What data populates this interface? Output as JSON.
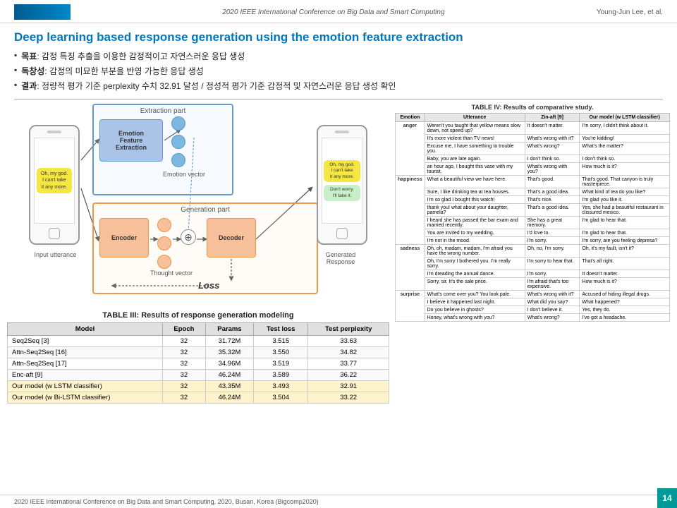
{
  "header": {
    "conference": "2020 IEEE International Conference on Big Data and Smart Computing",
    "author": "Young-Jun Lee, et al."
  },
  "title": "Deep learning based response generation using the emotion feature extraction",
  "bullets": [
    {
      "label": "목표",
      "text": ": 감정 특징 추출을 이용한 감정적이고 자연스러운 응답 생성"
    },
    {
      "label": "독창성",
      "text": ": 감정의 미묘한 부분을 반영 가능한 응답 생성"
    },
    {
      "label": "결과",
      "text": ": 정량적 평가 기준 perplexity 수치 32.91 달성 / 정성적 평가 기준 감정적 및 자연스러운 응답 생성 확인"
    }
  ],
  "diagram": {
    "extraction_label": "Extraction part",
    "efe_label": "Emotion\nFeature\nExtraction",
    "emotion_vector_label": "Emotion vector",
    "generation_label": "Generation part",
    "encoder_label": "Encoder",
    "decoder_label": "Decoder",
    "thought_vector_label": "Thought vector",
    "loss_label": "Loss",
    "input_label": "Input utterance",
    "output_label": "Generated Response",
    "phone_left_text": "Oh, my god.\nI can't take\nit any more.",
    "phone_right_text1": "Oh, my god.\nI can't take\nit any more.",
    "phone_right_text2": "Don't worry.\nI'll take it."
  },
  "table3": {
    "title": "TABLE III: Results of response generation modeling",
    "columns": [
      "Model",
      "Epoch",
      "Params",
      "Test loss",
      "Test perplexity"
    ],
    "rows": [
      [
        "Seq2Seq [3]",
        "32",
        "31.72M",
        "3.515",
        "33.63"
      ],
      [
        "Attn-Seq2Seq [16]",
        "32",
        "35.32M",
        "3.550",
        "34.82"
      ],
      [
        "Attn-Seq2Seq [17]",
        "32",
        "34.96M",
        "3.519",
        "33.77"
      ],
      [
        "Enc-aft [9]",
        "32",
        "46.24M",
        "3.589",
        "36.22"
      ],
      [
        "Our model (w LSTM classifier)",
        "32",
        "43.35M",
        "3.493",
        "32.91"
      ],
      [
        "Our model (w Bi-LSTM classifier)",
        "32",
        "46.24M",
        "3.504",
        "33.22"
      ]
    ]
  },
  "table4": {
    "title": "TABLE IV: Results of comparative study.",
    "columns": [
      "Emotion",
      "Utterance",
      "Zin-aft [9]",
      "Our model (w LSTM classifier)"
    ],
    "rows": [
      {
        "emotion": "anger",
        "entries": [
          [
            "Weren't you taught that yellow means slow down, not speed up?",
            "It doesn't matter.",
            "I'm sorry, I didn't think about it."
          ],
          [
            "It's more violent than TV news!",
            "What's wrong with it?",
            "You're kidding!"
          ],
          [
            "Excuse me, I have something to trouble you.",
            "What's wrong?",
            "What's the matter?"
          ],
          [
            "Baby, you are late again.",
            "I don't think so.",
            "I don't think so."
          ],
          [
            "an hour ago, I bought this vase with my tourist.",
            "What's wrong with you?",
            "How much is it?"
          ]
        ]
      },
      {
        "emotion": "happiness",
        "entries": [
          [
            "What a beautiful view we have here.",
            "That's good.",
            "That's good. That canyon is truly masterpiece."
          ],
          [
            "Sure, I like drinking tea at tea houses.",
            "That's a good idea.",
            "What kind of tea do you like?"
          ],
          [
            "I'm so glad I bought this watch!",
            "That's nice.",
            "I'm glad you like it."
          ],
          [
            "thank you! what about your daughter, pamela?",
            "That's a good idea.",
            "Yes, she had a beautiful restaurant in clissured mexico."
          ],
          [
            "I heard she has passed the bar exam and married recently.",
            "She has a great memory.",
            "I'm glad to hear that."
          ],
          [
            "You are invited to my wedding.",
            "I'd love to.",
            "I'm glad to hear that."
          ],
          [
            "I'm not in the mood.",
            "I'm sorry.",
            "I'm sorry, are you feeling depresa?"
          ]
        ]
      },
      {
        "emotion": "sadness",
        "entries": [
          [
            "Oh, oh, madam, madam, I'm afraid you have the wrong number.",
            "Oh, no, I'm sorry.",
            "Oh, it's my fault, isn't it?"
          ],
          [
            "Oh, I'm sorry I bothered you. I'm really sorry.",
            "I'm sorry to hear that.",
            "That's all right."
          ],
          [
            "I'm dreading the annual dance.",
            "I'm sorry.",
            "It doesn't matter."
          ],
          [
            "Sorry, sir. It's the sale price.",
            "I'm afraid that's too expensive.",
            "How much is it?"
          ]
        ]
      },
      {
        "emotion": "surprise",
        "entries": [
          [
            "What's come over you? You look pale.",
            "What's wrong with it?",
            "Accused of hiding illegal drugs."
          ],
          [
            "I believe it happened last night.",
            "What did you say?",
            "What happened?"
          ],
          [
            "Do you believe in ghosts?",
            "I don't believe it.",
            "Yes, they do."
          ],
          [
            "Honey, what's wrong with you?",
            "What's wrong?",
            "I've got a headache."
          ]
        ]
      }
    ]
  },
  "footer": {
    "text": "2020 IEEE International Conference on Big Data and Smart Computing, 2020, Busan, Korea (Bigcomp2020)"
  },
  "page": "14"
}
